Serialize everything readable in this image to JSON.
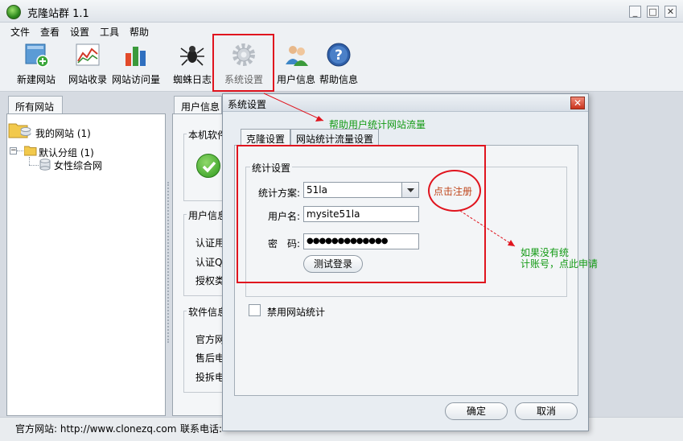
{
  "window": {
    "title": "克隆站群 1.1",
    "min_label": "_",
    "max_label": "□",
    "close_label": "✕"
  },
  "menu": [
    "文件",
    "查看",
    "设置",
    "工具",
    "帮助"
  ],
  "toolbar": [
    {
      "label": "新建网站",
      "icon": "new-site-icon"
    },
    {
      "label": "网站收录",
      "icon": "chart-line-icon"
    },
    {
      "label": "网站访问量",
      "icon": "bar-chart-icon"
    },
    {
      "label": "蜘蛛日志",
      "icon": "spider-icon"
    },
    {
      "label": "系统设置",
      "icon": "gear-icon"
    },
    {
      "label": "用户信息",
      "icon": "users-icon"
    },
    {
      "label": "帮助信息",
      "icon": "help-icon"
    }
  ],
  "left": {
    "tab": "所有网站",
    "tree": [
      {
        "label": "我的网站 (1)",
        "level": 0
      },
      {
        "label": "默认分组 (1)",
        "level": 1
      },
      {
        "label": "女性综合网",
        "level": 2
      }
    ]
  },
  "right": {
    "tab": "用户信息",
    "groups": [
      "本机软件",
      "用户信息",
      "软件信息"
    ],
    "user_rows": [
      "认证用",
      "认证Q",
      "授权类"
    ],
    "soft_rows": [
      "官方网",
      "售后电",
      "投拆电"
    ]
  },
  "status": {
    "website": "官方网站: http://www.clonezq.com",
    "phone": "联系电话:"
  },
  "dialog": {
    "title": "系统设置",
    "close": "✕",
    "tabs": [
      "克隆设置",
      "网站统计流量设置"
    ],
    "group_title": "统计设置",
    "scheme_label": "统计方案:",
    "scheme_value": "51la",
    "username_label": "用户名:",
    "username_value": "mysite51la",
    "password_label": "密　码:",
    "password_value": "●●●●●●●●●●●●●",
    "register_label": "点击注册",
    "test_login": "测试登录",
    "disable_stats": "禁用网站统计",
    "ok": "确定",
    "cancel": "取消"
  },
  "annotations": {
    "top_note": "帮助用户统计网站流量",
    "side_note_1": "如果没有统",
    "side_note_2": "计账号，点此申请"
  },
  "colors": {
    "annot_red": "#e0141e",
    "annot_green": "#139a14"
  }
}
